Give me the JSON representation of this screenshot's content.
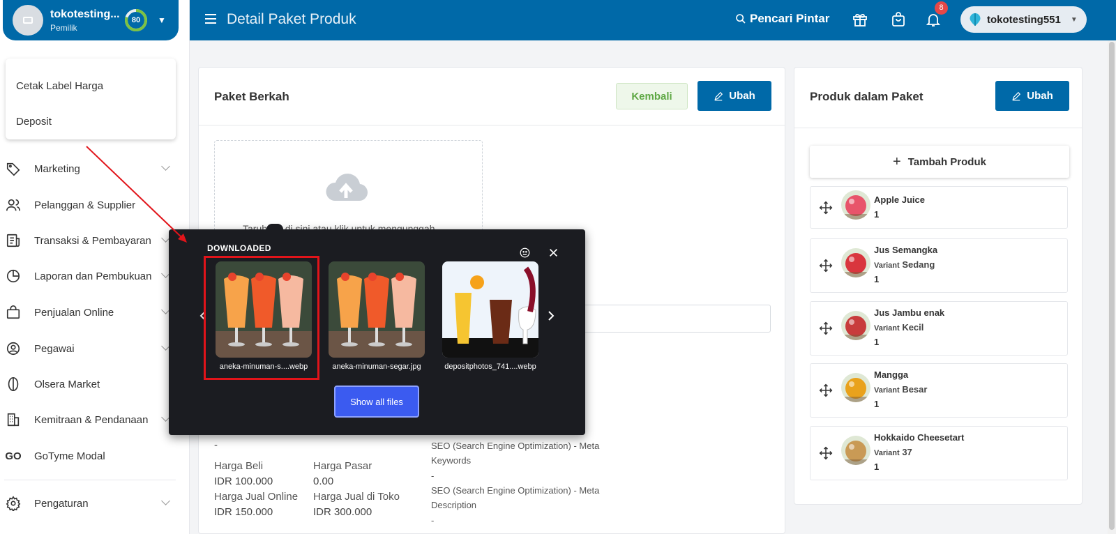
{
  "sidebar": {
    "store": {
      "name": "tokotesting...",
      "role": "Pemilik",
      "progress": 80
    },
    "quick_items": [
      "Cetak Label Harga",
      "Deposit"
    ],
    "nav": [
      {
        "label": "Marketing",
        "icon": "tag-icon",
        "chevron": true
      },
      {
        "label": "Pelanggan & Supplier",
        "icon": "users-icon",
        "chevron": false
      },
      {
        "label": "Transaksi & Pembayaran",
        "icon": "receipt-icon",
        "chevron": true
      },
      {
        "label": "Laporan dan Pembukuan",
        "icon": "pie-chart-icon",
        "chevron": true
      },
      {
        "label": "Penjualan Online",
        "icon": "shopping-bag-icon",
        "chevron": true
      },
      {
        "label": "Pegawai",
        "icon": "user-circle-icon",
        "chevron": true
      },
      {
        "label": "Olsera Market",
        "icon": "market-pin-icon",
        "chevron": false
      },
      {
        "label": "Kemitraan & Pendanaan",
        "icon": "building-icon",
        "chevron": true
      },
      {
        "label": "GoTyme Modal",
        "icon": "gotyme-logo-icon",
        "chevron": false
      },
      {
        "label": "Pengaturan",
        "icon": "gear-icon",
        "chevron": true
      }
    ]
  },
  "header": {
    "title": "Detail Paket Produk",
    "search_label": "Pencari Pintar",
    "notification_count": "8",
    "user_name": "tokotesting551"
  },
  "main": {
    "title": "Paket Berkah",
    "back_label": "Kembali",
    "edit_label": "Ubah",
    "upload_hint": "Taruh file di sini atau klik untuk mengunggah",
    "dash_1": "-",
    "prices": {
      "buy_label": "Harga Beli",
      "buy_value": "IDR 100.000",
      "market_label": "Harga Pasar",
      "market_value": "0.00",
      "market_dash": "-",
      "online_label": "Harga Jual Online",
      "online_value": "IDR 150.000",
      "store_label": "Harga Jual di Toko",
      "store_value": "IDR 300.000"
    },
    "seo": {
      "keywords_label": "SEO (Search Engine Optimization) - Meta Keywords",
      "keywords_value": "-",
      "description_label": "SEO (Search Engine Optimization) - Meta Description",
      "description_value": "-"
    }
  },
  "side": {
    "title": "Produk dalam Paket",
    "edit_label": "Ubah",
    "add_label": "Tambah Produk",
    "variant_prefix": "Variant",
    "products": [
      {
        "name": "Apple Juice",
        "variant": "",
        "qty": "1",
        "color": "#e8546a"
      },
      {
        "name": "Jus Semangka",
        "variant": "Sedang",
        "qty": "1",
        "color": "#d9363e"
      },
      {
        "name": "Jus Jambu enak",
        "variant": "Kecil",
        "qty": "1",
        "color": "#c83c3c"
      },
      {
        "name": "Mangga",
        "variant": "Besar",
        "qty": "1",
        "color": "#e9a21c"
      },
      {
        "name": "Hokkaido Cheesetart",
        "variant": "37",
        "qty": "1",
        "color": "#c99a55"
      }
    ]
  },
  "downloads": {
    "title": "DOWNLOADED",
    "files": [
      {
        "name": "aneka-minuman-s....webp",
        "icon": "drinks-thumbnail"
      },
      {
        "name": "aneka-minuman-segar.jpg",
        "icon": "drinks-thumbnail"
      },
      {
        "name": "depositphotos_741....webp",
        "icon": "glasses-thumbnail"
      }
    ],
    "show_all_label": "Show all files"
  },
  "colors": {
    "brand": "#0069a8",
    "highlight": "#e1141a",
    "popup_bg": "#1b1c21",
    "popup_button": "#3b5bf0"
  }
}
